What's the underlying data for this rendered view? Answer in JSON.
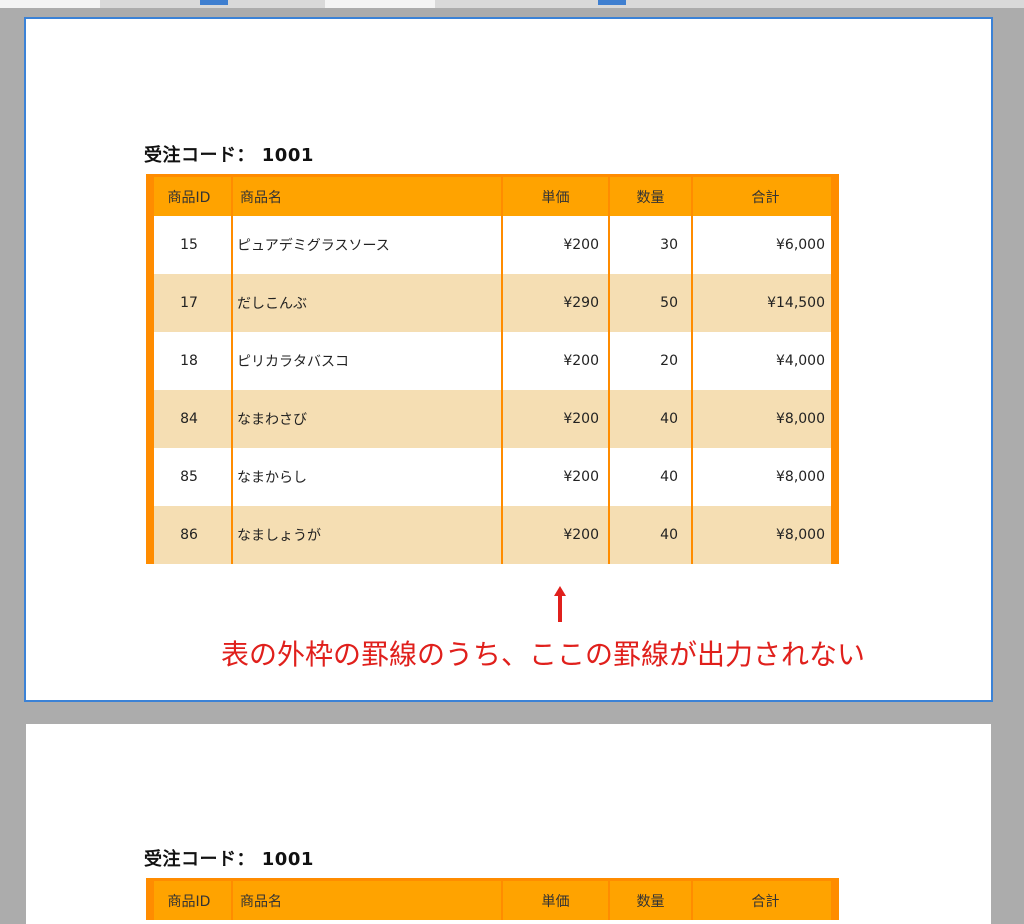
{
  "colors": {
    "header_bg": "#ffa300",
    "border": "#ff8c00",
    "row_even": "#f5deb3",
    "row_odd": "#ffffff",
    "annotation": "#e0201c",
    "page_outline": "#3b82d6"
  },
  "page1": {
    "order_title": "受注コード： 1001",
    "headers": {
      "id": "商品ID",
      "name": "商品名",
      "price": "単価",
      "qty": "数量",
      "total": "合計"
    },
    "rows": [
      {
        "id": "15",
        "name": "ピュアデミグラスソース",
        "price": "¥200",
        "qty": "30",
        "total": "¥6,000"
      },
      {
        "id": "17",
        "name": "だしこんぶ",
        "price": "¥290",
        "qty": "50",
        "total": "¥14,500"
      },
      {
        "id": "18",
        "name": "ピリカラタバスコ",
        "price": "¥200",
        "qty": "20",
        "total": "¥4,000"
      },
      {
        "id": "84",
        "name": "なまわさび",
        "price": "¥200",
        "qty": "40",
        "total": "¥8,000"
      },
      {
        "id": "85",
        "name": "なまからし",
        "price": "¥200",
        "qty": "40",
        "total": "¥8,000"
      },
      {
        "id": "86",
        "name": "なましょうが",
        "price": "¥200",
        "qty": "40",
        "total": "¥8,000"
      }
    ],
    "annotation": {
      "arrow_icon": "up-arrow-icon",
      "text": "表の外枠の罫線のうち、ここの罫線が出力されない"
    }
  },
  "page2": {
    "order_title": "受注コード： 1001",
    "headers": {
      "id": "商品ID",
      "name": "商品名",
      "price": "単価",
      "qty": "数量",
      "total": "合計"
    }
  }
}
